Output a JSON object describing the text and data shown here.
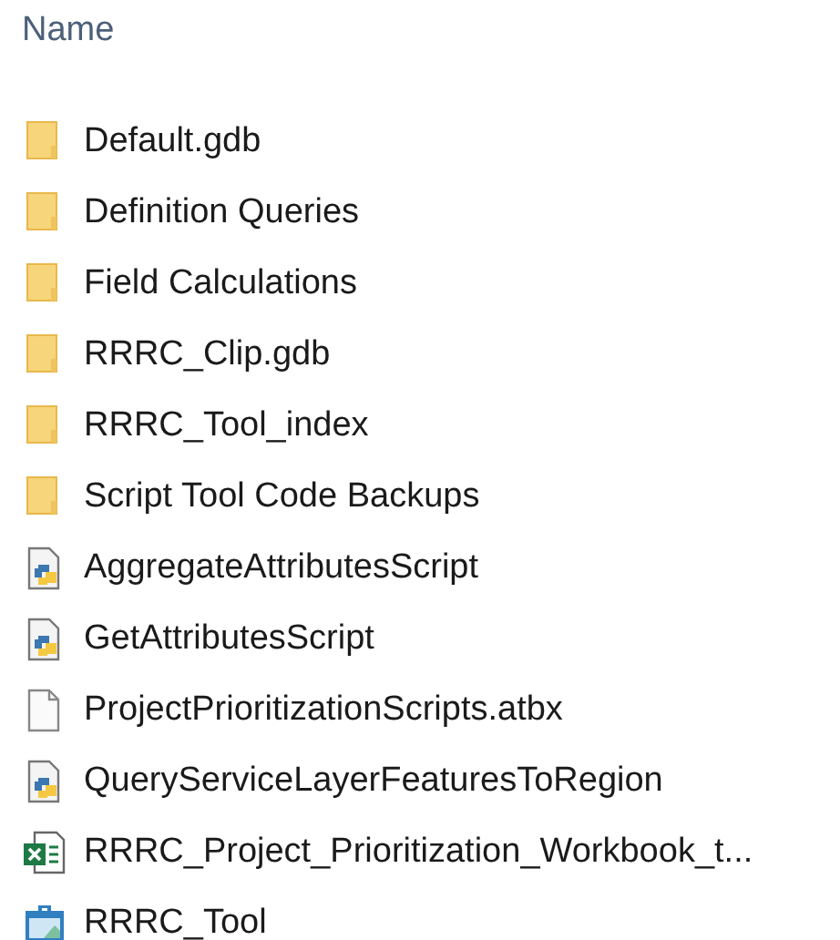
{
  "header": {
    "label": "Name"
  },
  "files": [
    {
      "name": "Default.gdb",
      "kind": "folder"
    },
    {
      "name": "Definition Queries",
      "kind": "folder"
    },
    {
      "name": "Field Calculations",
      "kind": "folder"
    },
    {
      "name": "RRRC_Clip.gdb",
      "kind": "folder"
    },
    {
      "name": "RRRC_Tool_index",
      "kind": "folder"
    },
    {
      "name": "Script Tool Code Backups",
      "kind": "folder"
    },
    {
      "name": "AggregateAttributesScript",
      "kind": "python"
    },
    {
      "name": "GetAttributesScript",
      "kind": "python"
    },
    {
      "name": "ProjectPrioritizationScripts.atbx",
      "kind": "file"
    },
    {
      "name": "QueryServiceLayerFeaturesToRegion",
      "kind": "python"
    },
    {
      "name": "RRRC_Project_Prioritization_Workbook_t...",
      "kind": "excel"
    },
    {
      "name": "RRRC_Tool",
      "kind": "toolbox"
    }
  ]
}
